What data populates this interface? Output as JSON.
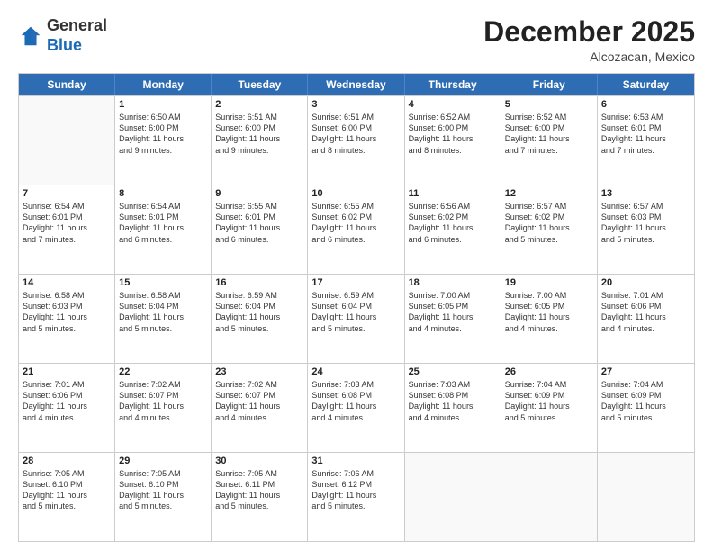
{
  "header": {
    "logo_general": "General",
    "logo_blue": "Blue",
    "month_title": "December 2025",
    "location": "Alcozacan, Mexico"
  },
  "days_of_week": [
    "Sunday",
    "Monday",
    "Tuesday",
    "Wednesday",
    "Thursday",
    "Friday",
    "Saturday"
  ],
  "weeks": [
    [
      {
        "day": "",
        "lines": []
      },
      {
        "day": "1",
        "lines": [
          "Sunrise: 6:50 AM",
          "Sunset: 6:00 PM",
          "Daylight: 11 hours",
          "and 9 minutes."
        ]
      },
      {
        "day": "2",
        "lines": [
          "Sunrise: 6:51 AM",
          "Sunset: 6:00 PM",
          "Daylight: 11 hours",
          "and 9 minutes."
        ]
      },
      {
        "day": "3",
        "lines": [
          "Sunrise: 6:51 AM",
          "Sunset: 6:00 PM",
          "Daylight: 11 hours",
          "and 8 minutes."
        ]
      },
      {
        "day": "4",
        "lines": [
          "Sunrise: 6:52 AM",
          "Sunset: 6:00 PM",
          "Daylight: 11 hours",
          "and 8 minutes."
        ]
      },
      {
        "day": "5",
        "lines": [
          "Sunrise: 6:52 AM",
          "Sunset: 6:00 PM",
          "Daylight: 11 hours",
          "and 7 minutes."
        ]
      },
      {
        "day": "6",
        "lines": [
          "Sunrise: 6:53 AM",
          "Sunset: 6:01 PM",
          "Daylight: 11 hours",
          "and 7 minutes."
        ]
      }
    ],
    [
      {
        "day": "7",
        "lines": [
          "Sunrise: 6:54 AM",
          "Sunset: 6:01 PM",
          "Daylight: 11 hours",
          "and 7 minutes."
        ]
      },
      {
        "day": "8",
        "lines": [
          "Sunrise: 6:54 AM",
          "Sunset: 6:01 PM",
          "Daylight: 11 hours",
          "and 6 minutes."
        ]
      },
      {
        "day": "9",
        "lines": [
          "Sunrise: 6:55 AM",
          "Sunset: 6:01 PM",
          "Daylight: 11 hours",
          "and 6 minutes."
        ]
      },
      {
        "day": "10",
        "lines": [
          "Sunrise: 6:55 AM",
          "Sunset: 6:02 PM",
          "Daylight: 11 hours",
          "and 6 minutes."
        ]
      },
      {
        "day": "11",
        "lines": [
          "Sunrise: 6:56 AM",
          "Sunset: 6:02 PM",
          "Daylight: 11 hours",
          "and 6 minutes."
        ]
      },
      {
        "day": "12",
        "lines": [
          "Sunrise: 6:57 AM",
          "Sunset: 6:02 PM",
          "Daylight: 11 hours",
          "and 5 minutes."
        ]
      },
      {
        "day": "13",
        "lines": [
          "Sunrise: 6:57 AM",
          "Sunset: 6:03 PM",
          "Daylight: 11 hours",
          "and 5 minutes."
        ]
      }
    ],
    [
      {
        "day": "14",
        "lines": [
          "Sunrise: 6:58 AM",
          "Sunset: 6:03 PM",
          "Daylight: 11 hours",
          "and 5 minutes."
        ]
      },
      {
        "day": "15",
        "lines": [
          "Sunrise: 6:58 AM",
          "Sunset: 6:04 PM",
          "Daylight: 11 hours",
          "and 5 minutes."
        ]
      },
      {
        "day": "16",
        "lines": [
          "Sunrise: 6:59 AM",
          "Sunset: 6:04 PM",
          "Daylight: 11 hours",
          "and 5 minutes."
        ]
      },
      {
        "day": "17",
        "lines": [
          "Sunrise: 6:59 AM",
          "Sunset: 6:04 PM",
          "Daylight: 11 hours",
          "and 5 minutes."
        ]
      },
      {
        "day": "18",
        "lines": [
          "Sunrise: 7:00 AM",
          "Sunset: 6:05 PM",
          "Daylight: 11 hours",
          "and 4 minutes."
        ]
      },
      {
        "day": "19",
        "lines": [
          "Sunrise: 7:00 AM",
          "Sunset: 6:05 PM",
          "Daylight: 11 hours",
          "and 4 minutes."
        ]
      },
      {
        "day": "20",
        "lines": [
          "Sunrise: 7:01 AM",
          "Sunset: 6:06 PM",
          "Daylight: 11 hours",
          "and 4 minutes."
        ]
      }
    ],
    [
      {
        "day": "21",
        "lines": [
          "Sunrise: 7:01 AM",
          "Sunset: 6:06 PM",
          "Daylight: 11 hours",
          "and 4 minutes."
        ]
      },
      {
        "day": "22",
        "lines": [
          "Sunrise: 7:02 AM",
          "Sunset: 6:07 PM",
          "Daylight: 11 hours",
          "and 4 minutes."
        ]
      },
      {
        "day": "23",
        "lines": [
          "Sunrise: 7:02 AM",
          "Sunset: 6:07 PM",
          "Daylight: 11 hours",
          "and 4 minutes."
        ]
      },
      {
        "day": "24",
        "lines": [
          "Sunrise: 7:03 AM",
          "Sunset: 6:08 PM",
          "Daylight: 11 hours",
          "and 4 minutes."
        ]
      },
      {
        "day": "25",
        "lines": [
          "Sunrise: 7:03 AM",
          "Sunset: 6:08 PM",
          "Daylight: 11 hours",
          "and 4 minutes."
        ]
      },
      {
        "day": "26",
        "lines": [
          "Sunrise: 7:04 AM",
          "Sunset: 6:09 PM",
          "Daylight: 11 hours",
          "and 5 minutes."
        ]
      },
      {
        "day": "27",
        "lines": [
          "Sunrise: 7:04 AM",
          "Sunset: 6:09 PM",
          "Daylight: 11 hours",
          "and 5 minutes."
        ]
      }
    ],
    [
      {
        "day": "28",
        "lines": [
          "Sunrise: 7:05 AM",
          "Sunset: 6:10 PM",
          "Daylight: 11 hours",
          "and 5 minutes."
        ]
      },
      {
        "day": "29",
        "lines": [
          "Sunrise: 7:05 AM",
          "Sunset: 6:10 PM",
          "Daylight: 11 hours",
          "and 5 minutes."
        ]
      },
      {
        "day": "30",
        "lines": [
          "Sunrise: 7:05 AM",
          "Sunset: 6:11 PM",
          "Daylight: 11 hours",
          "and 5 minutes."
        ]
      },
      {
        "day": "31",
        "lines": [
          "Sunrise: 7:06 AM",
          "Sunset: 6:12 PM",
          "Daylight: 11 hours",
          "and 5 minutes."
        ]
      },
      {
        "day": "",
        "lines": []
      },
      {
        "day": "",
        "lines": []
      },
      {
        "day": "",
        "lines": []
      }
    ]
  ]
}
